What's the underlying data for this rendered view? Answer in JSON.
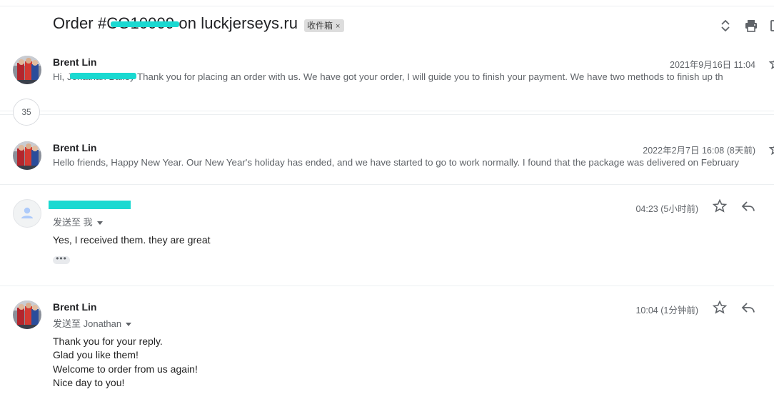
{
  "thread": {
    "subject": "Order #CO10009 on luckjerseys.ru",
    "label": "收件箱",
    "label_close": "×",
    "collapsed_count": "35"
  },
  "messages": [
    {
      "sender": "Brent Lin",
      "date": "2021年9月16日 11:04",
      "snippet": "Hi, Jonathan Bailey Thank you for placing an order with us. We have got your order, I will guide you to finish your payment. We have two methods to finish up th"
    },
    {
      "sender": "Brent Lin",
      "date": "2022年2月7日 16:08 (8天前)",
      "snippet": "Hello friends, Happy New Year. Our New Year's holiday has ended, and we have started to go to work normally. I found that the package was delivered on February"
    },
    {
      "sender": "",
      "date": "04:23 (5小时前)",
      "to": "发送至 我",
      "body": [
        "Yes, I received them. they are great"
      ],
      "ellipsis": "•••"
    },
    {
      "sender": "Brent Lin",
      "date": "10:04 (1分钟前)",
      "to": "发送至 Jonathan",
      "body": [
        "Thank you for your reply.",
        "Glad you like them!",
        "Welcome to order from us again!",
        "Nice day to you!"
      ]
    }
  ],
  "icons": {
    "expand": "unfold-icon",
    "print": "print-icon",
    "newwindow": "new-window-icon",
    "star": "star-icon",
    "reply": "reply-icon"
  },
  "colors": {
    "redaction": "#1ad9d1",
    "label_bg": "#dddddd",
    "muted": "#5f6368"
  }
}
